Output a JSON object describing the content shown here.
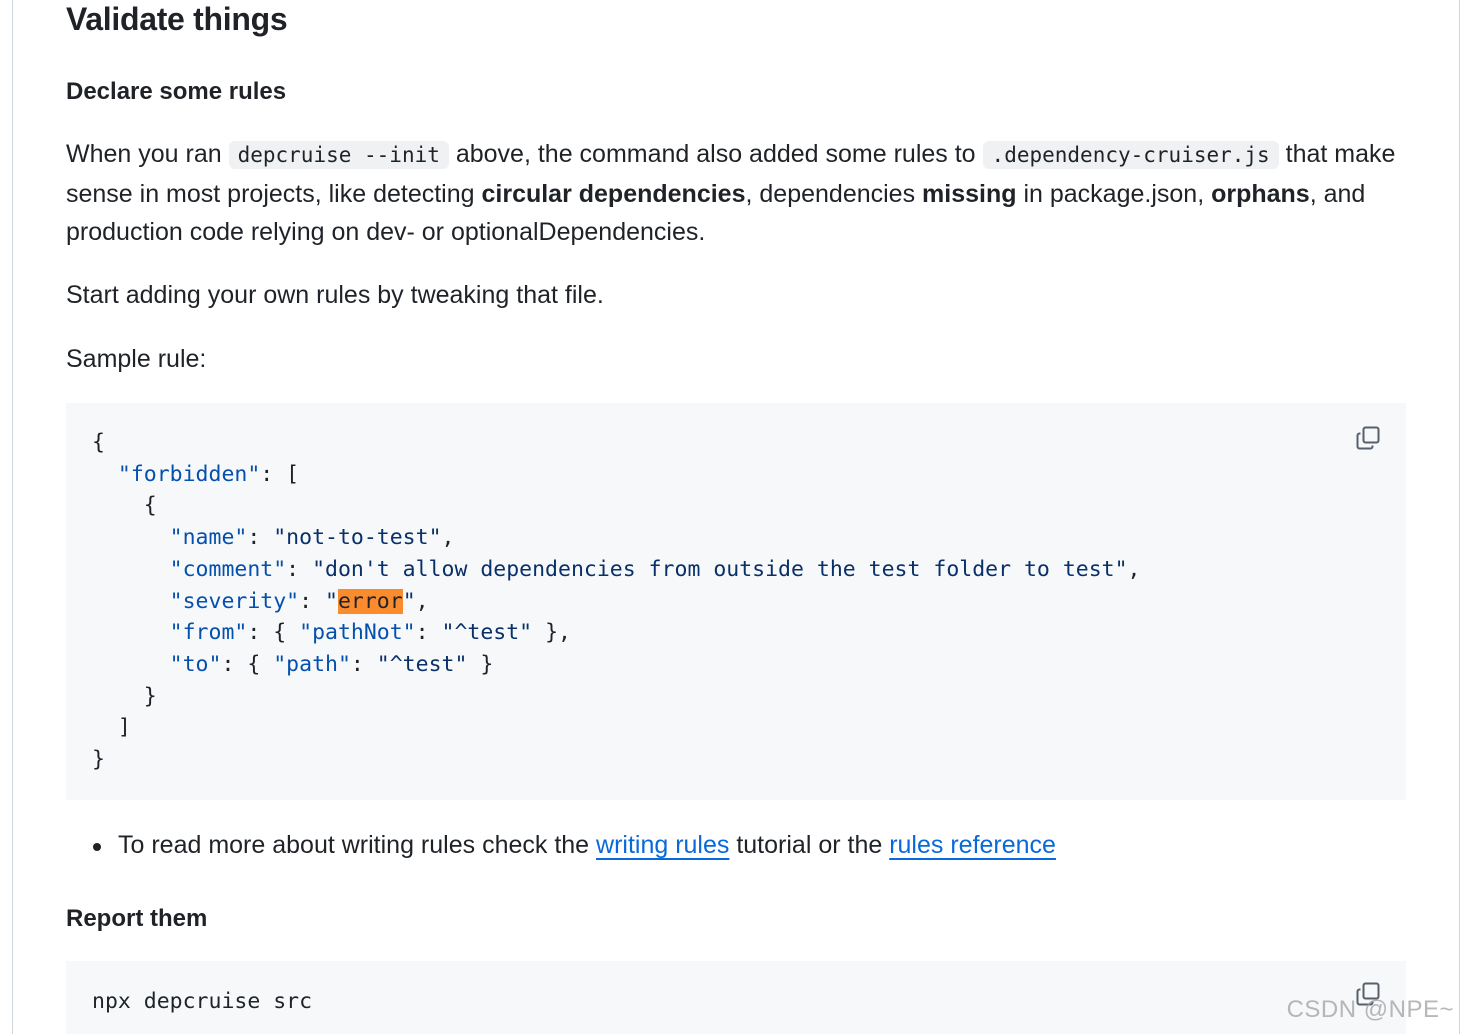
{
  "section": {
    "title": "Validate things"
  },
  "declare": {
    "heading": "Declare some rules",
    "p1": {
      "t1": "When you ran ",
      "code1": "depcruise --init",
      "t2": " above, the command also added some rules to ",
      "code2": ".dependency-cruiser.js",
      "t3": " that make sense in most projects, like detecting ",
      "b1": "circular dependencies",
      "t4": ", dependencies ",
      "b2": "missing",
      "t5": " in package.json, ",
      "b3": "orphans",
      "t6": ", and production code relying on dev- or optionalDependencies."
    },
    "p2": "Start adding your own rules by tweaking that file.",
    "p3": "Sample rule:"
  },
  "sample_code": {
    "lines": {
      "l1": "{",
      "l2_key": "\"forbidden\"",
      "l2_rest": ": [",
      "l3": "    {",
      "name_key": "\"name\"",
      "name_val": "\"not-to-test\"",
      "comment_key": "\"comment\"",
      "comment_val": "\"don't allow dependencies from outside the test folder to test\"",
      "severity_key": "\"severity\"",
      "severity_q1": "\"",
      "severity_val": "error",
      "severity_q2": "\"",
      "from_key": "\"from\"",
      "pathnot_key": "\"pathNot\"",
      "pathnot_val": "\"^test\"",
      "to_key": "\"to\"",
      "path_key": "\"path\"",
      "path_val": "\"^test\"",
      "l10": "    }",
      "l11": "  ]",
      "l12": "}"
    },
    "copy_icon": "copy-icon"
  },
  "bullets": {
    "item1": {
      "t1": "To read more about writing rules check the ",
      "link1": "writing rules",
      "t2": " tutorial or the ",
      "link2": "rules reference"
    }
  },
  "report": {
    "heading": "Report them",
    "command": "npx depcruise src",
    "copy_icon": "copy-icon"
  },
  "watermark": "CSDN @NPE~"
}
